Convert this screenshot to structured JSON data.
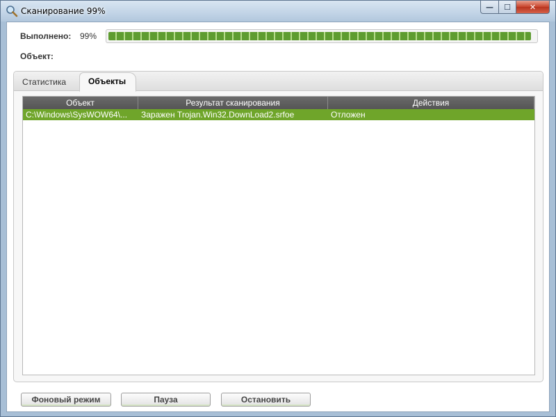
{
  "window": {
    "title": "Сканирование 99%",
    "minimize_glyph": "—",
    "maximize_glyph": "☐",
    "close_glyph": "✕"
  },
  "status": {
    "done_label": "Выполнено:",
    "done_value": "99%",
    "progress": 0.99,
    "object_label": "Объект:"
  },
  "tabs": [
    {
      "label": "Статистика",
      "active": false
    },
    {
      "label": "Объекты",
      "active": true
    }
  ],
  "table": {
    "columns": [
      "Объект",
      "Результат сканирования",
      "Действия"
    ],
    "rows": [
      [
        "C:\\Windows\\SysWOW64\\...",
        "Заражен Trojan.Win32.DownLoad2.srfoe",
        "Отложен"
      ]
    ]
  },
  "buttons": {
    "background": "Фоновый режим",
    "pause": "Пауза",
    "stop": "Остановить"
  },
  "colors": {
    "progress_fill": "#6fa52a",
    "row_highlight": "#6fa52a",
    "header_bg": "#5e5e5e"
  },
  "icons": {
    "title": "magnifier-icon"
  }
}
